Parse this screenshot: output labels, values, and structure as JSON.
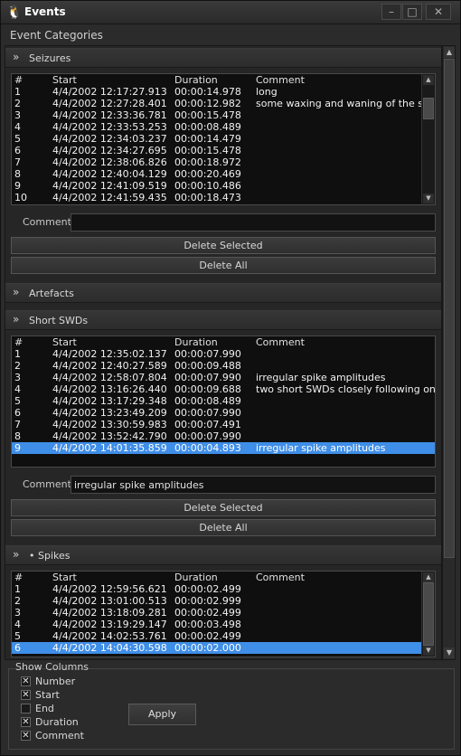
{
  "window": {
    "title": "Events",
    "category_label": "Event Categories"
  },
  "columns": {
    "num": "#",
    "start": "Start",
    "duration": "Duration",
    "comment": "Comment"
  },
  "sections": {
    "seizures": {
      "title": "Seizures",
      "rows": [
        {
          "n": "1",
          "start": "4/4/2002 12:17:27.913",
          "dur": "00:00:14.978",
          "comment": "long"
        },
        {
          "n": "2",
          "start": "4/4/2002 12:27:28.401",
          "dur": "00:00:12.982",
          "comment": "some waxing and waning of the spike"
        },
        {
          "n": "3",
          "start": "4/4/2002 12:33:36.781",
          "dur": "00:00:15.478",
          "comment": ""
        },
        {
          "n": "4",
          "start": "4/4/2002 12:33:53.253",
          "dur": "00:00:08.489",
          "comment": ""
        },
        {
          "n": "5",
          "start": "4/4/2002 12:34:03.237",
          "dur": "00:00:14.479",
          "comment": ""
        },
        {
          "n": "6",
          "start": "4/4/2002 12:34:27.695",
          "dur": "00:00:15.478",
          "comment": ""
        },
        {
          "n": "7",
          "start": "4/4/2002 12:38:06.826",
          "dur": "00:00:18.972",
          "comment": ""
        },
        {
          "n": "8",
          "start": "4/4/2002 12:40:04.129",
          "dur": "00:00:20.469",
          "comment": ""
        },
        {
          "n": "9",
          "start": "4/4/2002 12:41:09.519",
          "dur": "00:00:10.486",
          "comment": ""
        },
        {
          "n": "10",
          "start": "4/4/2002 12:41:59.435",
          "dur": "00:00:18.473",
          "comment": ""
        }
      ],
      "comment_label": "Comment",
      "comment_value": "",
      "delete_selected": "Delete Selected",
      "delete_all": "Delete All"
    },
    "artefacts": {
      "title": "Artefacts"
    },
    "short_swds": {
      "title": "Short SWDs",
      "rows": [
        {
          "n": "1",
          "start": "4/4/2002 12:35:02.137",
          "dur": "00:00:07.990",
          "comment": ""
        },
        {
          "n": "2",
          "start": "4/4/2002 12:40:27.589",
          "dur": "00:00:09.488",
          "comment": ""
        },
        {
          "n": "3",
          "start": "4/4/2002 12:58:07.804",
          "dur": "00:00:07.990",
          "comment": "irregular spike amplitudes"
        },
        {
          "n": "4",
          "start": "4/4/2002 13:16:26.440",
          "dur": "00:00:09.688",
          "comment": "two short SWDs closely following one afte"
        },
        {
          "n": "5",
          "start": "4/4/2002 13:17:29.348",
          "dur": "00:00:08.489",
          "comment": ""
        },
        {
          "n": "6",
          "start": "4/4/2002 13:23:49.209",
          "dur": "00:00:07.990",
          "comment": ""
        },
        {
          "n": "7",
          "start": "4/4/2002 13:30:59.983",
          "dur": "00:00:07.491",
          "comment": ""
        },
        {
          "n": "8",
          "start": "4/4/2002 13:52:42.790",
          "dur": "00:00:07.990",
          "comment": ""
        },
        {
          "n": "9",
          "start": "4/4/2002 14:01:35.859",
          "dur": "00:00:04.893",
          "comment": "irregular spike amplitudes",
          "selected": true
        }
      ],
      "comment_label": "Comment",
      "comment_value": "irregular spike amplitudes",
      "delete_selected": "Delete Selected",
      "delete_all": "Delete All"
    },
    "spikes": {
      "title": "• Spikes",
      "rows": [
        {
          "n": "1",
          "start": "4/4/2002 12:59:56.621",
          "dur": "00:00:02.499",
          "comment": ""
        },
        {
          "n": "2",
          "start": "4/4/2002 13:01:00.513",
          "dur": "00:00:02.999",
          "comment": ""
        },
        {
          "n": "3",
          "start": "4/4/2002 13:18:09.281",
          "dur": "00:00:02.499",
          "comment": ""
        },
        {
          "n": "4",
          "start": "4/4/2002 13:19:29.147",
          "dur": "00:00:03.498",
          "comment": ""
        },
        {
          "n": "5",
          "start": "4/4/2002 14:02:53.761",
          "dur": "00:00:02.499",
          "comment": ""
        },
        {
          "n": "6",
          "start": "4/4/2002 14:04:30.598",
          "dur": "00:00:02.000",
          "comment": "",
          "selected": true
        }
      ]
    }
  },
  "show_columns": {
    "title": "Show Columns",
    "options": [
      {
        "label": "Number",
        "checked": true
      },
      {
        "label": "Start",
        "checked": true
      },
      {
        "label": "End",
        "checked": false
      },
      {
        "label": "Duration",
        "checked": true
      },
      {
        "label": "Comment",
        "checked": true
      }
    ],
    "apply_label": "Apply"
  },
  "icons": {
    "app": "tux-penguin-icon",
    "expanded": "double-chevron-down-icon",
    "collapsed": "double-chevron-right-icon"
  },
  "colors": {
    "selection": "#3f8ee8",
    "background": "#2b2b2b",
    "table_bg": "#0f0f0f"
  }
}
